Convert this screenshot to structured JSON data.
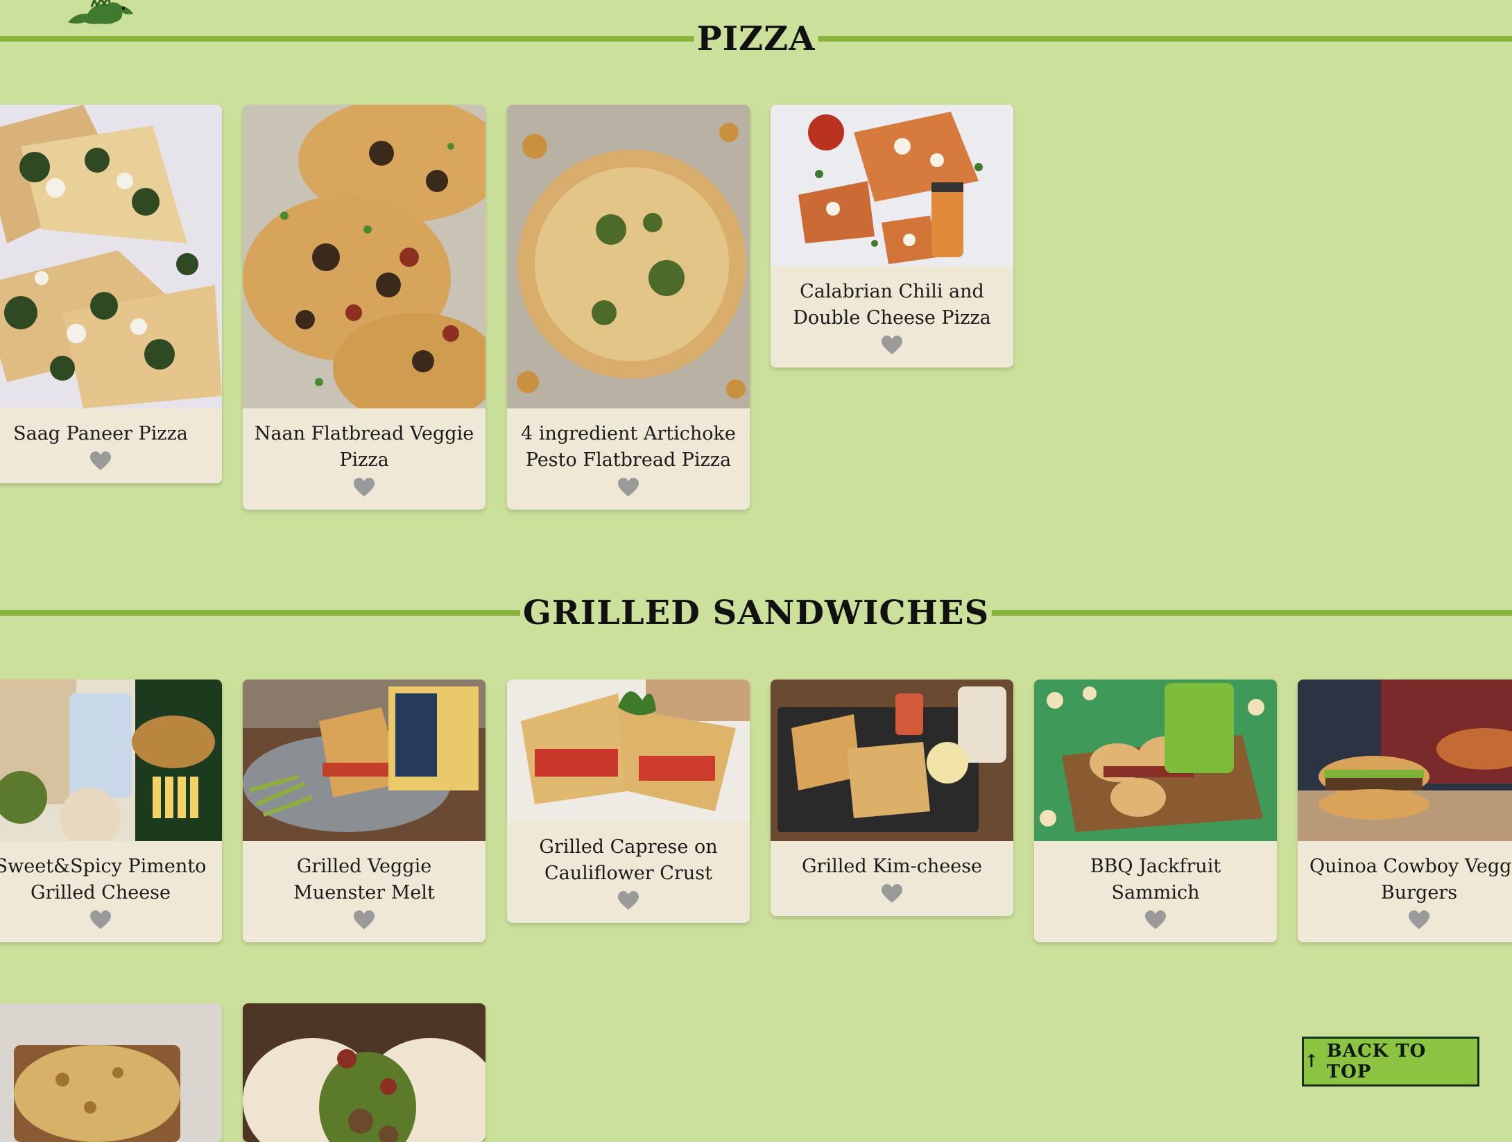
{
  "sections": [
    {
      "title": "PIZZA",
      "cards": [
        {
          "title": "Saag Paneer Pizza"
        },
        {
          "title": "Naan Flatbread Veggie Pizza"
        },
        {
          "title": "4 ingredient Artichoke Pesto Flatbread Pizza"
        },
        {
          "title": "Calabrian Chili and Double Cheese Pizza"
        }
      ]
    },
    {
      "title": "GRILLED SANDWICHES",
      "cards": [
        {
          "title": "Sweet&Spicy Pimento Grilled Cheese"
        },
        {
          "title": "Grilled Veggie Muenster Melt"
        },
        {
          "title": "Grilled Caprese on Cauliflower Crust"
        },
        {
          "title": "Grilled Kim-cheese"
        },
        {
          "title": "BBQ Jackfruit Sammich"
        },
        {
          "title": "Quinoa Cowboy Veggie Burgers"
        }
      ]
    }
  ],
  "back_to_top": {
    "label": "BACK TO TOP",
    "icon": "arrow-up-icon"
  },
  "colors": {
    "background": "#cbe09a",
    "rule": "#87b43a",
    "card": "#efe8d6",
    "button": "#8cc442",
    "heart": "#9a9a9a"
  }
}
